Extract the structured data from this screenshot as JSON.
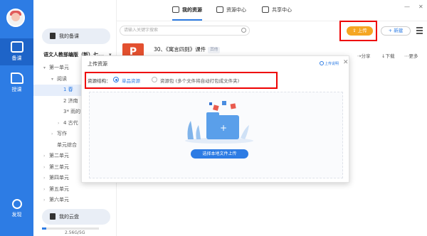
{
  "rail": {
    "items": [
      {
        "label": "备课"
      },
      {
        "label": "授课"
      },
      {
        "label": "发现"
      }
    ]
  },
  "sidebar": {
    "my_prep": "我的备课",
    "book": "语文人教部编版（新）七...",
    "tree": [
      {
        "label": "第一单元",
        "level": 1,
        "arrow": "▾"
      },
      {
        "label": "阅读",
        "level": 2,
        "arrow": "▾"
      },
      {
        "label": "1 春",
        "level": 3,
        "arrow": "",
        "selected": true
      },
      {
        "label": "2 济南",
        "level": 3,
        "arrow": ""
      },
      {
        "label": "3* 雨的",
        "level": 3,
        "arrow": ""
      },
      {
        "label": "4 古代",
        "level": 3,
        "arrow": "›"
      },
      {
        "label": "写作",
        "level": 2,
        "arrow": "›"
      },
      {
        "label": "单元综合",
        "level": 2,
        "arrow": ""
      },
      {
        "label": "第二单元",
        "level": 1,
        "arrow": "›"
      },
      {
        "label": "第三单元",
        "level": 1,
        "arrow": "›"
      },
      {
        "label": "第四单元",
        "level": 1,
        "arrow": "›"
      },
      {
        "label": "第五单元",
        "level": 1,
        "arrow": "›"
      },
      {
        "label": "第六单元",
        "level": 1,
        "arrow": "›"
      }
    ],
    "my_cloud": "我的云盘",
    "storage": "2.56G/5G",
    "storage_fraction": 0.08
  },
  "tabs": [
    {
      "label": "我的资源",
      "active": true
    },
    {
      "label": "资源中心",
      "active": false
    },
    {
      "label": "共享中心",
      "active": false
    }
  ],
  "window": {
    "minimize": "—",
    "close": "✕"
  },
  "search": {
    "placeholder": "请输入关键字搜索"
  },
  "buttons": {
    "upload": "上传",
    "new": "新建"
  },
  "resource": {
    "icon_letter": "P",
    "title": "30、《寓言四则》课件",
    "tag": "其他",
    "share": "分享",
    "download": "下载",
    "more": "更多"
  },
  "modal": {
    "title": "上传资源",
    "help": "上传说明",
    "close": "✕",
    "structure_label": "资源结构：",
    "option_single": "单品资源",
    "option_pack": "资源包 (多个文件将自动打包成文件夹)",
    "pick_button": "选择本地文件上传"
  },
  "colors": {
    "brand": "#2d7ce4",
    "upload": "#f5a623",
    "highlight": "#e00000",
    "ppt": "#e3502f"
  }
}
